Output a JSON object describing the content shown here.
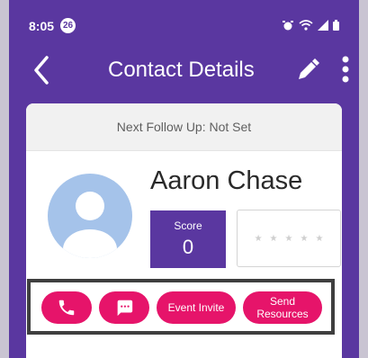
{
  "status_bar": {
    "time": "8:05",
    "notification_count": "26"
  },
  "header": {
    "title": "Contact Details"
  },
  "contact": {
    "followup_text": "Next Follow Up: Not Set",
    "name": "Aaron Chase",
    "score_label": "Score",
    "score_value": "0",
    "rating": 0,
    "rating_max": 5
  },
  "actions": {
    "call_icon": "phone-icon",
    "message_icon": "message-icon",
    "event_invite_label": "Event Invite",
    "send_resources_label_line1": "Send",
    "send_resources_label_line2": "Resources"
  },
  "colors": {
    "primary": "#5a37a0",
    "accent": "#e6146a",
    "avatar_bg": "#a5c3ea"
  }
}
